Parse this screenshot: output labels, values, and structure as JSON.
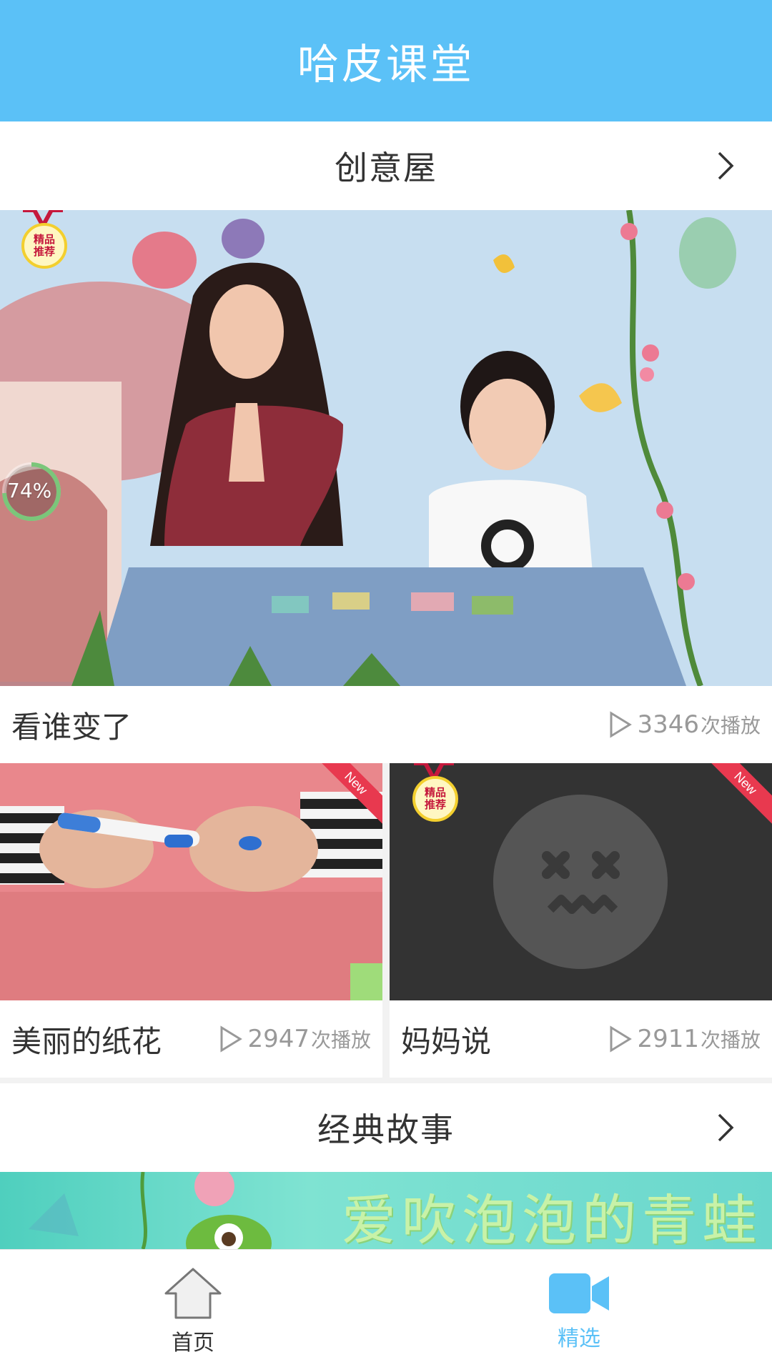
{
  "header": {
    "title": "哈皮课堂"
  },
  "sections": [
    {
      "title": "创意屋"
    },
    {
      "title": "经典故事"
    }
  ],
  "hero": {
    "badge": [
      "精品",
      "推荐"
    ],
    "progress": "74%",
    "title": "看谁变了",
    "plays": "3346",
    "plays_unit": "次播放"
  },
  "cards": [
    {
      "title": "美丽的纸花",
      "plays": "2947",
      "plays_unit": "次播放",
      "ribbon": "New"
    },
    {
      "title": "妈妈说",
      "plays": "2911",
      "plays_unit": "次播放",
      "ribbon": "New",
      "badge": [
        "精品",
        "推荐"
      ]
    }
  ],
  "banner": {
    "text": "爱吹泡泡的青蛙"
  },
  "nav": [
    {
      "label": "首页",
      "icon": "home-icon"
    },
    {
      "label": "精选",
      "icon": "video-camera-icon"
    }
  ],
  "colors": {
    "accent": "#5bc1f7",
    "ribbon": "#e8394f",
    "badge": "#c5183c"
  }
}
